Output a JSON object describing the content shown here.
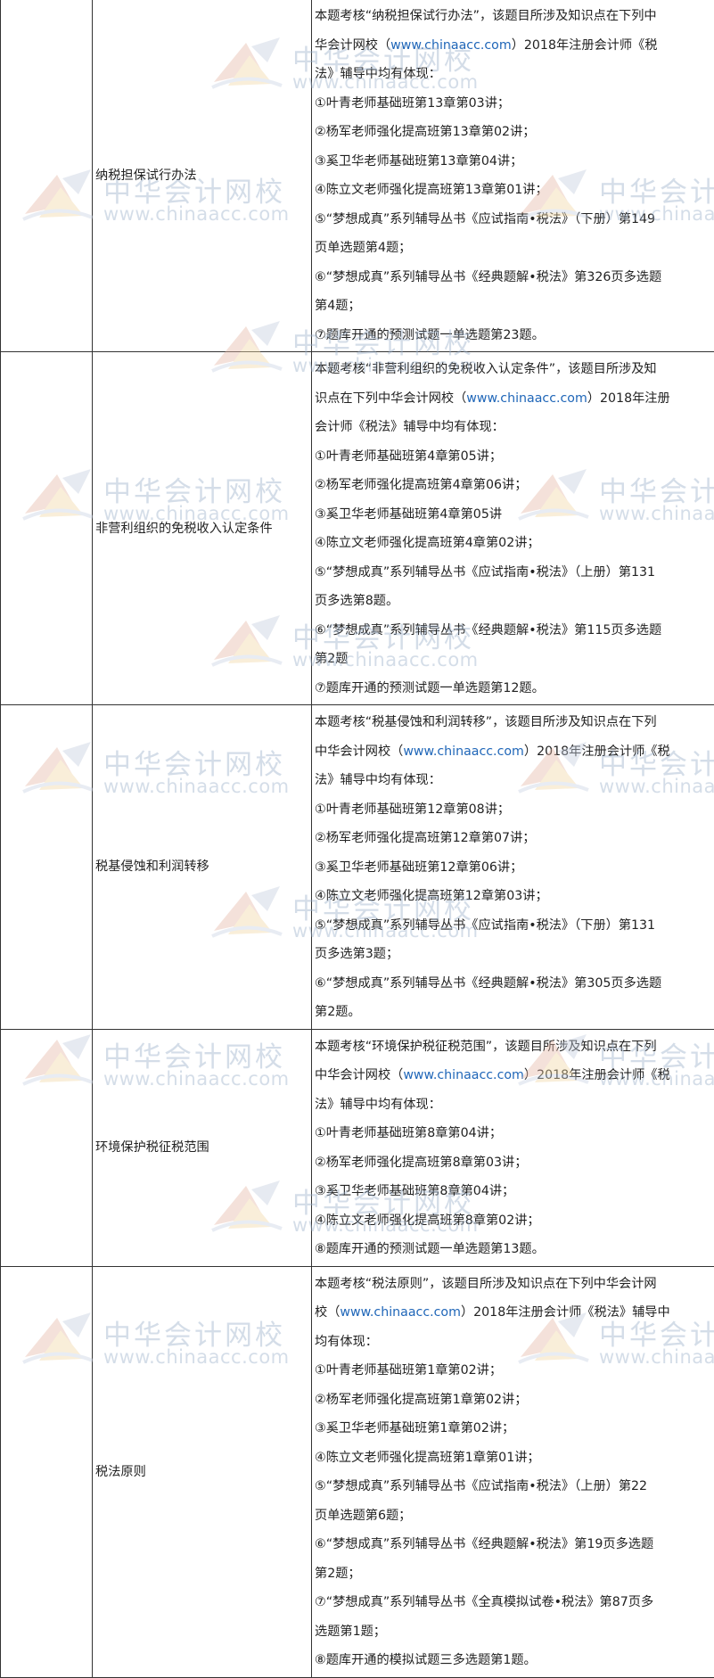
{
  "watermark": {
    "name_cn": "中华会计网校",
    "site": "www.chinaacc.com"
  },
  "rows": [
    {
      "topic": "纳税担保试行办法",
      "lines": [
        [
          "本题考核“纳税担保试行办法”，该题目所涉及知识点在下列中"
        ],
        [
          "华会计网校（",
          {
            "link": "www.chinaacc.com"
          },
          "）2018年注册会计师《税"
        ],
        [
          "法》辅导中均有体现："
        ],
        [
          "①叶青老师基础班第13章第03讲；"
        ],
        [
          "②杨军老师强化提高班第13章第02讲；"
        ],
        [
          "③奚卫华老师基础班第13章第04讲；"
        ],
        [
          "④陈立文老师强化提高班第13章第01讲；"
        ],
        [
          "⑤“梦想成真”系列辅导丛书《应试指南•税法》（下册）第149"
        ],
        [
          "页单选题第4题；"
        ],
        [
          "⑥“梦想成真”系列辅导丛书《经典题解•税法》第326页多选题"
        ],
        [
          "第4题；"
        ],
        [
          "⑦题库开通的预测试题一单选题第23题。"
        ]
      ]
    },
    {
      "topic": "非营利组织的免税收入认定条件",
      "lines": [
        [
          "本题考核“非营利组织的免税收入认定条件”，该题目所涉及知"
        ],
        [
          "识点在下列中华会计网校（",
          {
            "link": "www.chinaacc.com"
          },
          "）2018年注册"
        ],
        [
          "会计师《税法》辅导中均有体现："
        ],
        [
          "①叶青老师基础班第4章第05讲；"
        ],
        [
          "②杨军老师强化提高班第4章第06讲；"
        ],
        [
          "③奚卫华老师基础班第4章第05讲"
        ],
        [
          "④陈立文老师强化提高班第4章第02讲；"
        ],
        [
          "⑤“梦想成真”系列辅导丛书《应试指南•税法》（上册）第131"
        ],
        [
          "页多选第8题。"
        ],
        [
          "⑥“梦想成真”系列辅导丛书《经典题解•税法》第115页多选题"
        ],
        [
          "第2题"
        ],
        [
          "⑦题库开通的预测试题一单选题第12题。"
        ]
      ]
    },
    {
      "topic": "税基侵蚀和利润转移",
      "lines": [
        [
          "本题考核“税基侵蚀和利润转移”，该题目所涉及知识点在下列"
        ],
        [
          "中华会计网校（",
          {
            "link": "www.chinaacc.com"
          },
          "）2018年注册会计师《税"
        ],
        [
          "法》辅导中均有体现："
        ],
        [
          "①叶青老师基础班第12章第08讲；"
        ],
        [
          "②杨军老师强化提高班第12章第07讲；"
        ],
        [
          "③奚卫华老师基础班第12章第06讲；"
        ],
        [
          "④陈立文老师强化提高班第12章第03讲；"
        ],
        [
          "⑤“梦想成真”系列辅导丛书《应试指南•税法》（下册）第131"
        ],
        [
          "页多选第3题；"
        ],
        [
          "⑥“梦想成真”系列辅导丛书《经典题解•税法》第305页多选题"
        ],
        [
          "第2题。"
        ]
      ]
    },
    {
      "topic": "环境保护税征税范围",
      "lines": [
        [
          "本题考核“环境保护税征税范围”，该题目所涉及知识点在下列"
        ],
        [
          "中华会计网校（",
          {
            "link": "www.chinaacc.com"
          },
          "）2018年注册会计师《税"
        ],
        [
          "法》辅导中均有体现："
        ],
        [
          "①叶青老师基础班第8章第04讲；"
        ],
        [
          "②杨军老师强化提高班第8章第03讲；"
        ],
        [
          "③奚卫华老师基础班第8章第04讲；"
        ],
        [
          "④陈立文老师强化提高班第8章第02讲；"
        ],
        [
          "⑧题库开通的预测试题一单选题第13题。"
        ]
      ]
    },
    {
      "topic": "税法原则",
      "lines": [
        [
          "本题考核“税法原则”，该题目所涉及知识点在下列中华会计网"
        ],
        [
          "校（",
          {
            "link": "www.chinaacc.com"
          },
          "）2018年注册会计师《税法》辅导中"
        ],
        [
          "均有体现："
        ],
        [
          "①叶青老师基础班第1章第02讲；"
        ],
        [
          "②杨军老师强化提高班第1章第02讲；"
        ],
        [
          "③奚卫华老师基础班第1章第02讲；"
        ],
        [
          "④陈立文老师强化提高班第1章第01讲；"
        ],
        [
          "⑤“梦想成真”系列辅导丛书《应试指南•税法》（上册）第22"
        ],
        [
          "页单选题第6题；"
        ],
        [
          "⑥“梦想成真”系列辅导丛书《经典题解•税法》第19页多选题"
        ],
        [
          "第2题；"
        ],
        [
          "⑦“梦想成真”系列辅导丛书《全真模拟试卷•税法》第87页多"
        ],
        [
          "选题第1题；"
        ],
        [
          "⑧题库开通的模拟试题三多选题第1题。"
        ]
      ]
    }
  ]
}
